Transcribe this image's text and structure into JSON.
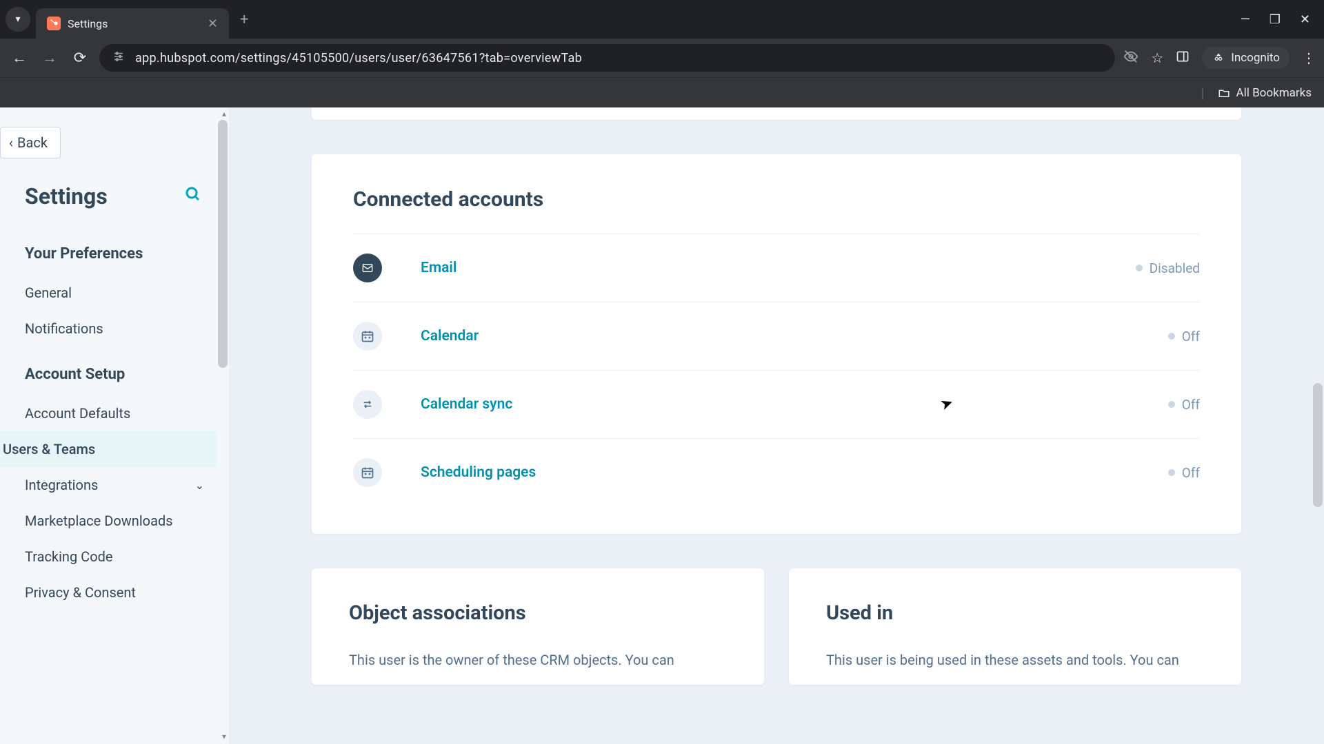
{
  "browser": {
    "tab_title": "Settings",
    "url": "app.hubspot.com/settings/45105500/users/user/63647561?tab=overviewTab",
    "incognito_label": "Incognito",
    "bookmarks_label": "All Bookmarks"
  },
  "sidebar": {
    "back_label": "Back",
    "title": "Settings",
    "sections": [
      {
        "header": "Your Preferences",
        "items": [
          {
            "label": "General"
          },
          {
            "label": "Notifications"
          }
        ]
      },
      {
        "header": "Account Setup",
        "items": [
          {
            "label": "Account Defaults"
          },
          {
            "label": "Users & Teams",
            "active": true
          },
          {
            "label": "Integrations",
            "expandable": true
          },
          {
            "label": "Marketplace Downloads"
          },
          {
            "label": "Tracking Code"
          },
          {
            "label": "Privacy & Consent"
          }
        ]
      }
    ]
  },
  "main": {
    "connected_accounts": {
      "title": "Connected accounts",
      "rows": [
        {
          "icon": "email",
          "name": "Email",
          "status": "Disabled"
        },
        {
          "icon": "calendar",
          "name": "Calendar",
          "status": "Off"
        },
        {
          "icon": "sync",
          "name": "Calendar sync",
          "status": "Off"
        },
        {
          "icon": "calendar",
          "name": "Scheduling pages",
          "status": "Off"
        }
      ]
    },
    "object_associations": {
      "title": "Object associations",
      "desc": "This user is the owner of these CRM objects. You can"
    },
    "used_in": {
      "title": "Used in",
      "desc": "This user is being used in these assets and tools. You can"
    }
  }
}
